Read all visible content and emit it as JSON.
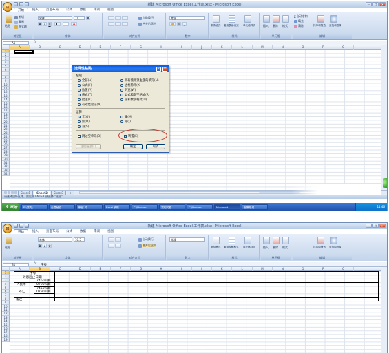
{
  "top": {
    "window_title": "新建 Microsoft Office Excel 工作表.xlsx - Microsoft Excel",
    "office_button": "⊞",
    "window_controls": [
      "—",
      "❐",
      "✕"
    ],
    "tabs": [
      "开始",
      "插入",
      "页面布局",
      "公式",
      "数据",
      "审阅",
      "视图"
    ],
    "ribbon": {
      "clipboard": {
        "label": "剪贴板",
        "paste": "粘贴",
        "cut": "剪切",
        "copy": "复制",
        "format_painter": "格式刷"
      },
      "font": {
        "label": "字体",
        "name": "宋体",
        "size": "11",
        "bold": "B",
        "italic": "I",
        "underline": "U",
        "grow": "A",
        "fontcolor": "A"
      },
      "alignment": {
        "label": "对齐方式",
        "wrap": "自动换行",
        "merge": "合并后居中"
      },
      "number": {
        "label": "数字",
        "format": "常规",
        "percent": "%",
        "comma": ","
      },
      "styles": {
        "label": "样式",
        "conditional": "条件格式",
        "table": "套用表格格式",
        "cell": "单元格样式"
      },
      "cells": {
        "label": "单元格",
        "insert": "插入",
        "delete": "删除",
        "format": "格式"
      },
      "editing": {
        "label": "编辑",
        "autosum": "自动求和",
        "fill": "填充",
        "clear": "清除",
        "sort": "排序和筛选",
        "find": "查找和选择"
      }
    },
    "name_box": "A1",
    "fx": "fx",
    "formula_value": "",
    "columns": [
      "A",
      "B",
      "C",
      "D",
      "E",
      "F",
      "G",
      "H",
      "I",
      "J",
      "K",
      "L",
      "M",
      "N",
      "O",
      "P",
      "Q"
    ],
    "rows": [
      "1",
      "2",
      "3",
      "4",
      "5",
      "6",
      "7",
      "8",
      "9",
      "10",
      "11",
      "12",
      "13",
      "14",
      "15",
      "16",
      "17",
      "18",
      "19",
      "20",
      "21",
      "22",
      "23",
      "24",
      "25",
      "26",
      "27",
      "28",
      "29",
      "30",
      "31",
      "32",
      "33",
      "34"
    ],
    "sheet_tabs": [
      "Sheet1",
      "Sheet2",
      "Sheet3"
    ],
    "status": "请选择目标区域，然后按 ENTER 或选择 \"粘贴\"",
    "taskbar": {
      "start": "开始",
      "buttons": [
        "E:\\我的\\...",
        "百度经验",
        "新建 文...",
        "Excel 表格",
        "C:\\Docum...",
        "我的文档",
        "C:\\Docum...",
        "Microsoft",
        "图像处理",
        "..."
      ],
      "clock": "11:46"
    },
    "dialog": {
      "title": "选择性粘贴",
      "help": "?",
      "close": "✕",
      "paste_section": "粘贴",
      "paste_left": [
        "全部(A)",
        "公式(F)",
        "数值(V)",
        "格式(T)",
        "批注(C)",
        "有效性验证(N)"
      ],
      "paste_right": [
        "所有使用源主题的单元(H)",
        "边框除外(X)",
        "列宽(W)",
        "公式和数字格式(R)",
        "值和数字格式(U)"
      ],
      "op_section": "运算",
      "op_left": [
        "无(O)",
        "加(D)",
        "减(S)"
      ],
      "op_right": [
        "乘(M)",
        "除(I)"
      ],
      "skip_blanks": "跳过空单元(B)",
      "transpose": "转置(E)",
      "transpose_check": "✓",
      "paste_link": "粘贴链接(L)",
      "ok": "确定",
      "cancel": "取消"
    }
  },
  "bottom": {
    "window_title": "新建 Microsoft Office Excel 工作表.xlsx - Microsoft Excel",
    "office_button": "⊞",
    "window_controls": [
      "—",
      "❐",
      "✕"
    ],
    "tabs": [
      "开始",
      "插入",
      "页面布局",
      "公式",
      "数据",
      "审阅",
      "视图"
    ],
    "ribbon": {
      "clipboard": {
        "label": "剪贴板",
        "paste": "粘贴"
      },
      "font": {
        "label": "字体",
        "name": "宋体",
        "size": "10.5"
      },
      "alignment": {
        "label": "对齐方式",
        "wrap": "自动换行",
        "merge": "合并后居中"
      },
      "number": {
        "label": "数字",
        "format": "常规"
      },
      "styles": {
        "label": "样式",
        "conditional": "条件格式",
        "table": "套用表格格式",
        "cell": "单元格样式"
      },
      "cells": {
        "label": "单元格",
        "insert": "插入",
        "delete": "删除",
        "format": "格式"
      },
      "editing": {
        "label": "编辑",
        "sort": "排序和筛选",
        "find": "查找和选择"
      }
    },
    "name_box": "B1",
    "fx": "fx",
    "formula_value": "序号",
    "columns": [
      "A",
      "B",
      "C",
      "D",
      "E",
      "F",
      "G",
      "H",
      "I",
      "J",
      "K",
      "L",
      "M",
      "N",
      "O",
      "P",
      "Q"
    ],
    "rows": [
      "1",
      "2",
      "3",
      "4",
      "5",
      "6",
      "7",
      "8",
      "9",
      "10",
      "11",
      "12",
      "13",
      "14",
      "15",
      "16",
      "17",
      "18",
      "19"
    ],
    "table": {
      "header": "序号",
      "r2": "计息起止日期",
      "group1": "人民币",
      "group1_items": [
        "7450科目",
        "0790科目"
      ],
      "group2": "外汇",
      "group2_items": [
        "7450科目",
        "0790科目"
      ],
      "remark": "备注"
    }
  }
}
